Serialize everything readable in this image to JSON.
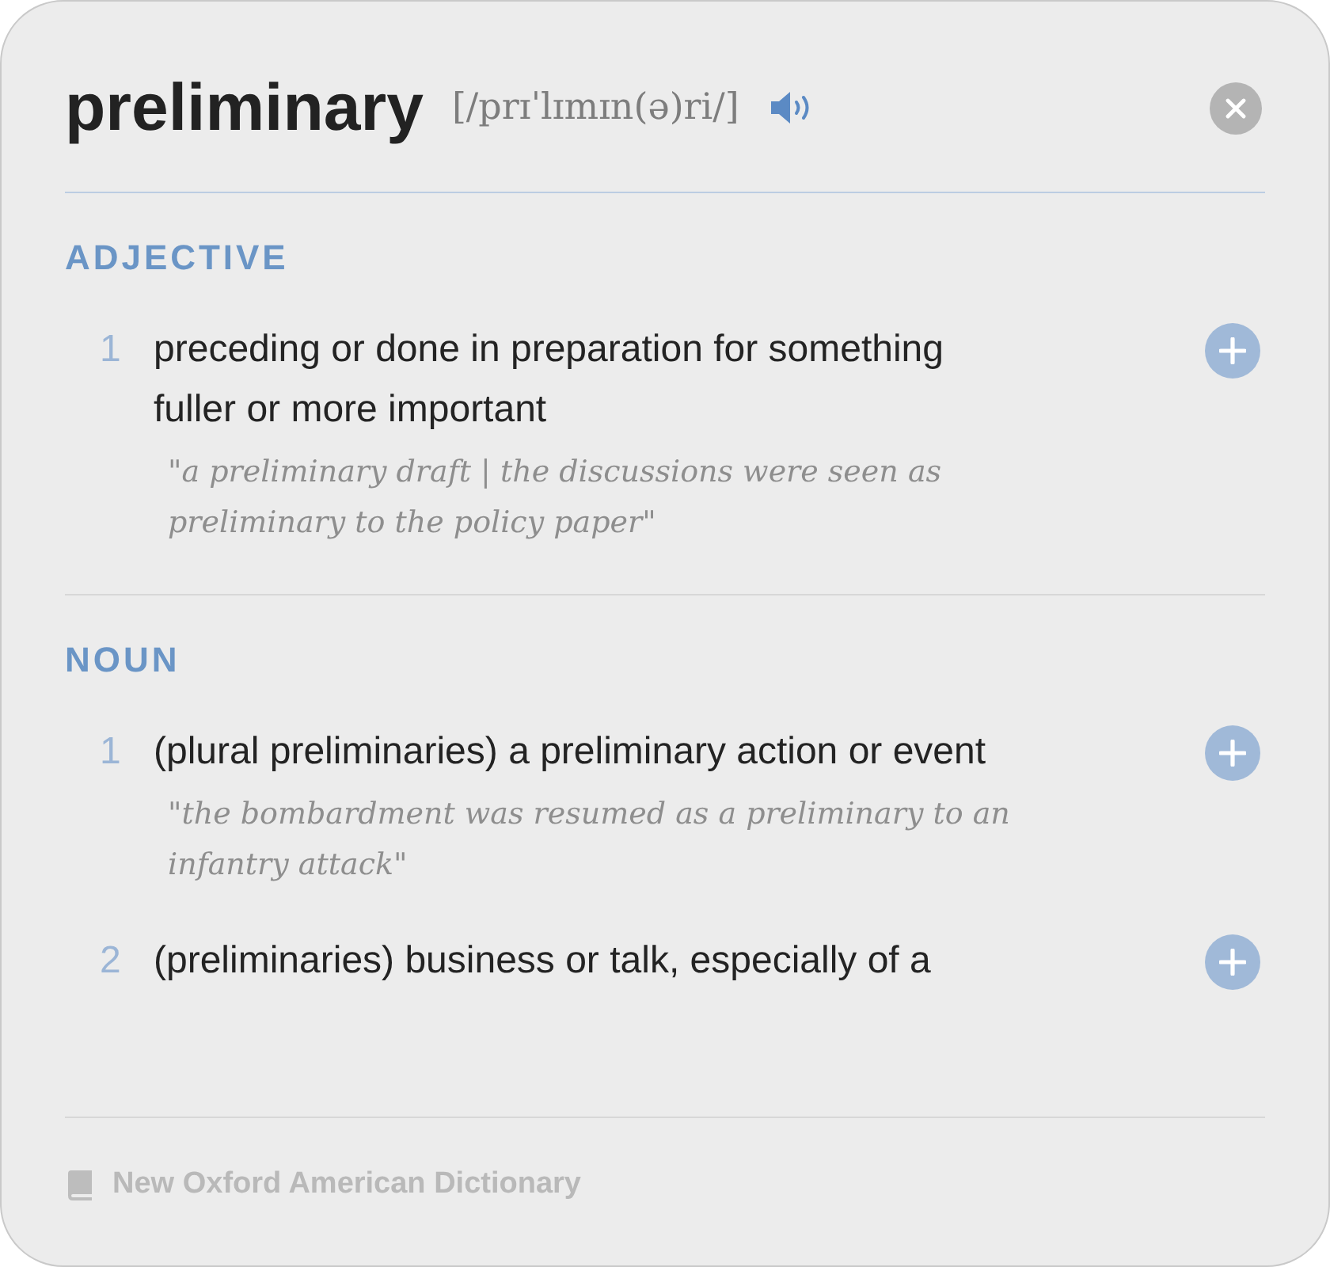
{
  "entry": {
    "headword": "preliminary",
    "pronunciation": "[/prɪˈlɪmɪn(ə)ri/]"
  },
  "sections": [
    {
      "part_of_speech": "ADJECTIVE",
      "senses": [
        {
          "number": "1",
          "definition": "preceding or done in preparation for something fuller or more important",
          "example": "\"a preliminary draft | the discussions were seen as preliminary to the policy paper\""
        }
      ]
    },
    {
      "part_of_speech": "NOUN",
      "senses": [
        {
          "number": "1",
          "definition": "(plural preliminaries) a preliminary action or event",
          "example": "\"the bombardment was resumed as a preliminary to an infantry attack\""
        },
        {
          "number": "2",
          "definition": "(preliminaries) business or talk, especially of a"
        }
      ]
    }
  ],
  "footer": {
    "source": "New Oxford American Dictionary"
  }
}
